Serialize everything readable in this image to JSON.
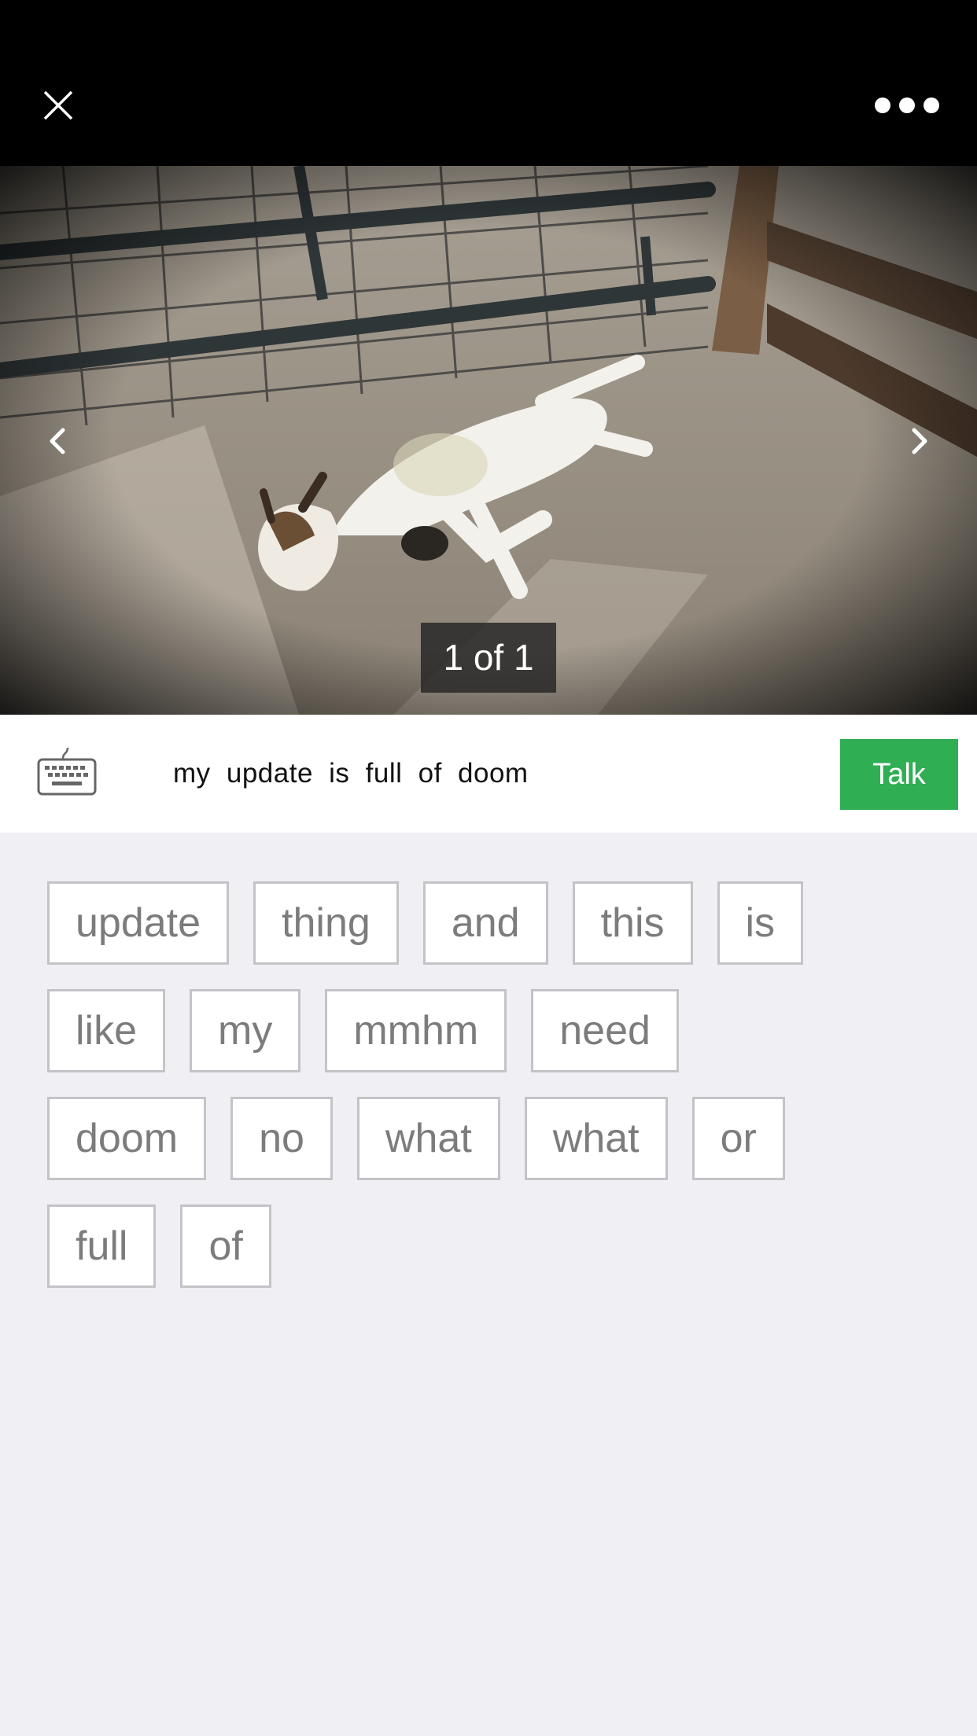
{
  "header": {
    "close_icon": "close-icon",
    "more_icon": "more-options-icon"
  },
  "viewer": {
    "counter": "1 of 1",
    "prev_icon": "chevron-left-icon",
    "next_icon": "chevron-right-icon"
  },
  "composer": {
    "keyboard_icon": "keyboard-icon",
    "text": "my  update  is  full  of  doom",
    "talk_label": "Talk",
    "talk_color": "#2fae54"
  },
  "word_bank": {
    "rows": [
      [
        "update",
        "thing",
        "and",
        "this",
        "is"
      ],
      [
        "like",
        "my",
        "mmhm",
        "need"
      ],
      [
        "doom",
        "no",
        "what",
        "what",
        "or"
      ],
      [
        "full",
        "of"
      ]
    ]
  }
}
